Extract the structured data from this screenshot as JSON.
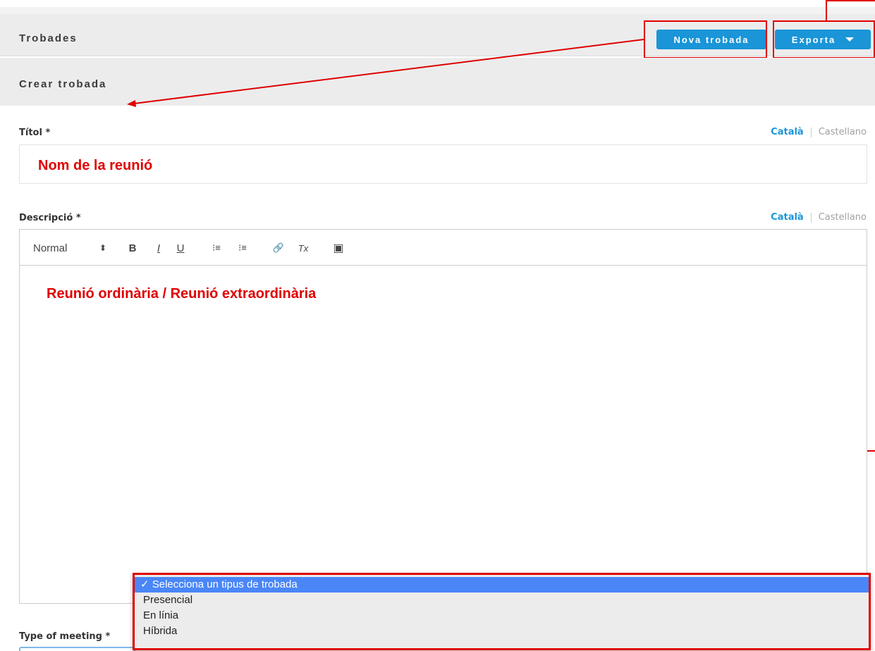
{
  "header": {
    "title": "Trobades",
    "new_button": "Nova trobada",
    "export_button": "Exporta"
  },
  "subheader": {
    "title": "Crear trobada"
  },
  "title_field": {
    "label": "Títol *",
    "lang_active": "Català",
    "lang_inactive": "Castellano",
    "annotation": "Nom de la reunió"
  },
  "description_field": {
    "label": "Descripció *",
    "lang_active": "Català",
    "lang_inactive": "Castellano",
    "format_select": "Normal",
    "toolbar_icons": [
      "select-arrows-icon",
      "bold-icon",
      "italic-icon",
      "underline-icon",
      "ordered-list-icon",
      "bullet-list-icon",
      "link-icon",
      "clear-format-icon",
      "video-icon"
    ],
    "toolbar_glyphs": {
      "select": "⬍",
      "bold": "B",
      "italic": "I",
      "underline": "U",
      "ordered": "⁝≡",
      "bullet": "⁝≡",
      "link": "🔗",
      "clear": "Tx",
      "video": "▣"
    },
    "annotation": "Reunió ordinària / Reunió extraordinària"
  },
  "meeting_type": {
    "label": "Type of meeting *",
    "options": [
      "✓ Selecciona un tipus de trobada",
      "Presencial",
      "En línia",
      "Híbrida"
    ],
    "selected_index": 0
  },
  "colors": {
    "accent": "#1a95d8",
    "annotation_red": "#e00000",
    "dropdown_highlight": "#4a86f7",
    "bar_background": "#ececec"
  }
}
